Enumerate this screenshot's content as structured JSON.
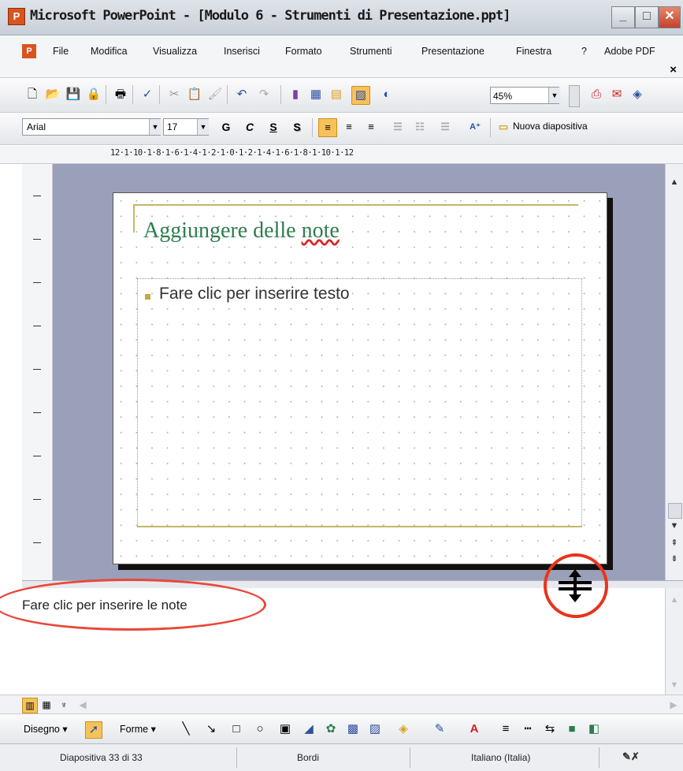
{
  "window": {
    "title": "Microsoft PowerPoint - [Modulo 6 - Strumenti di Presentazione.ppt]",
    "minimize": "_",
    "maximize": "□",
    "close": "✕"
  },
  "menu": {
    "items": [
      "File",
      "Modifica",
      "Visualizza",
      "Inserisci",
      "Formato",
      "Strumenti",
      "Presentazione",
      "Finestra",
      "?",
      "Adobe PDF"
    ],
    "close_doc": "×"
  },
  "toolbar": {
    "zoom": "45%",
    "font": "Arial",
    "font_size": "17",
    "bold": "G",
    "italic": "C",
    "underline": "S",
    "shadow": "S",
    "new_slide": "Nuova diapositiva"
  },
  "ruler": {
    "scale": "12·1·10·1·8·1·6·1·4·1·2·1·0·1·2·1·4·1·6·1·8·1·10·1·12"
  },
  "slide": {
    "title": "Aggiungere delle note",
    "title_plain": "Aggiungere delle ",
    "title_misspelled": "note",
    "body_placeholder": "Fare clic per inserire testo"
  },
  "notes": {
    "placeholder": "Fare clic per inserire le note"
  },
  "drawing_toolbar": {
    "draw_menu": "Disegno ▾",
    "shapes_menu": "Forme ▾"
  },
  "status": {
    "slide_count": "Diapositiva 33 di 33",
    "design": "Bordi",
    "language": "Italiano (Italia)"
  },
  "colors": {
    "annotation_red": "#e8341c",
    "title_green": "#2e7d4e",
    "accent_gold": "#c8b667",
    "workspace": "#9aa0b9"
  }
}
